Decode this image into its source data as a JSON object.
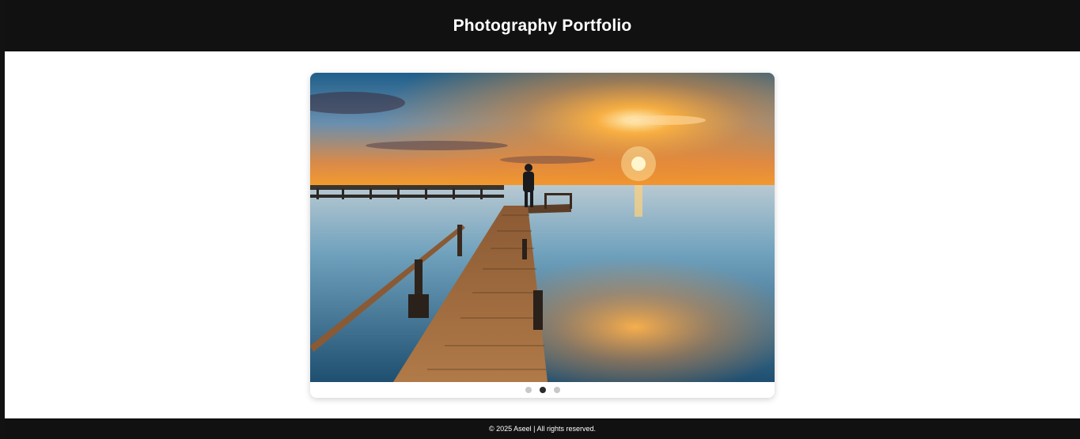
{
  "header": {
    "title": "Photography Portfolio"
  },
  "carousel": {
    "slide_count": 3,
    "active_index": 1,
    "image": {
      "subject": "sunset-pier-photo"
    }
  },
  "footer": {
    "text": "© 2025 Aseel | All rights reserved."
  },
  "colors": {
    "header_bg": "#111111",
    "footer_bg": "#111111",
    "dot_active": "#2b2b2b",
    "dot_inactive": "#c8c8c8"
  }
}
